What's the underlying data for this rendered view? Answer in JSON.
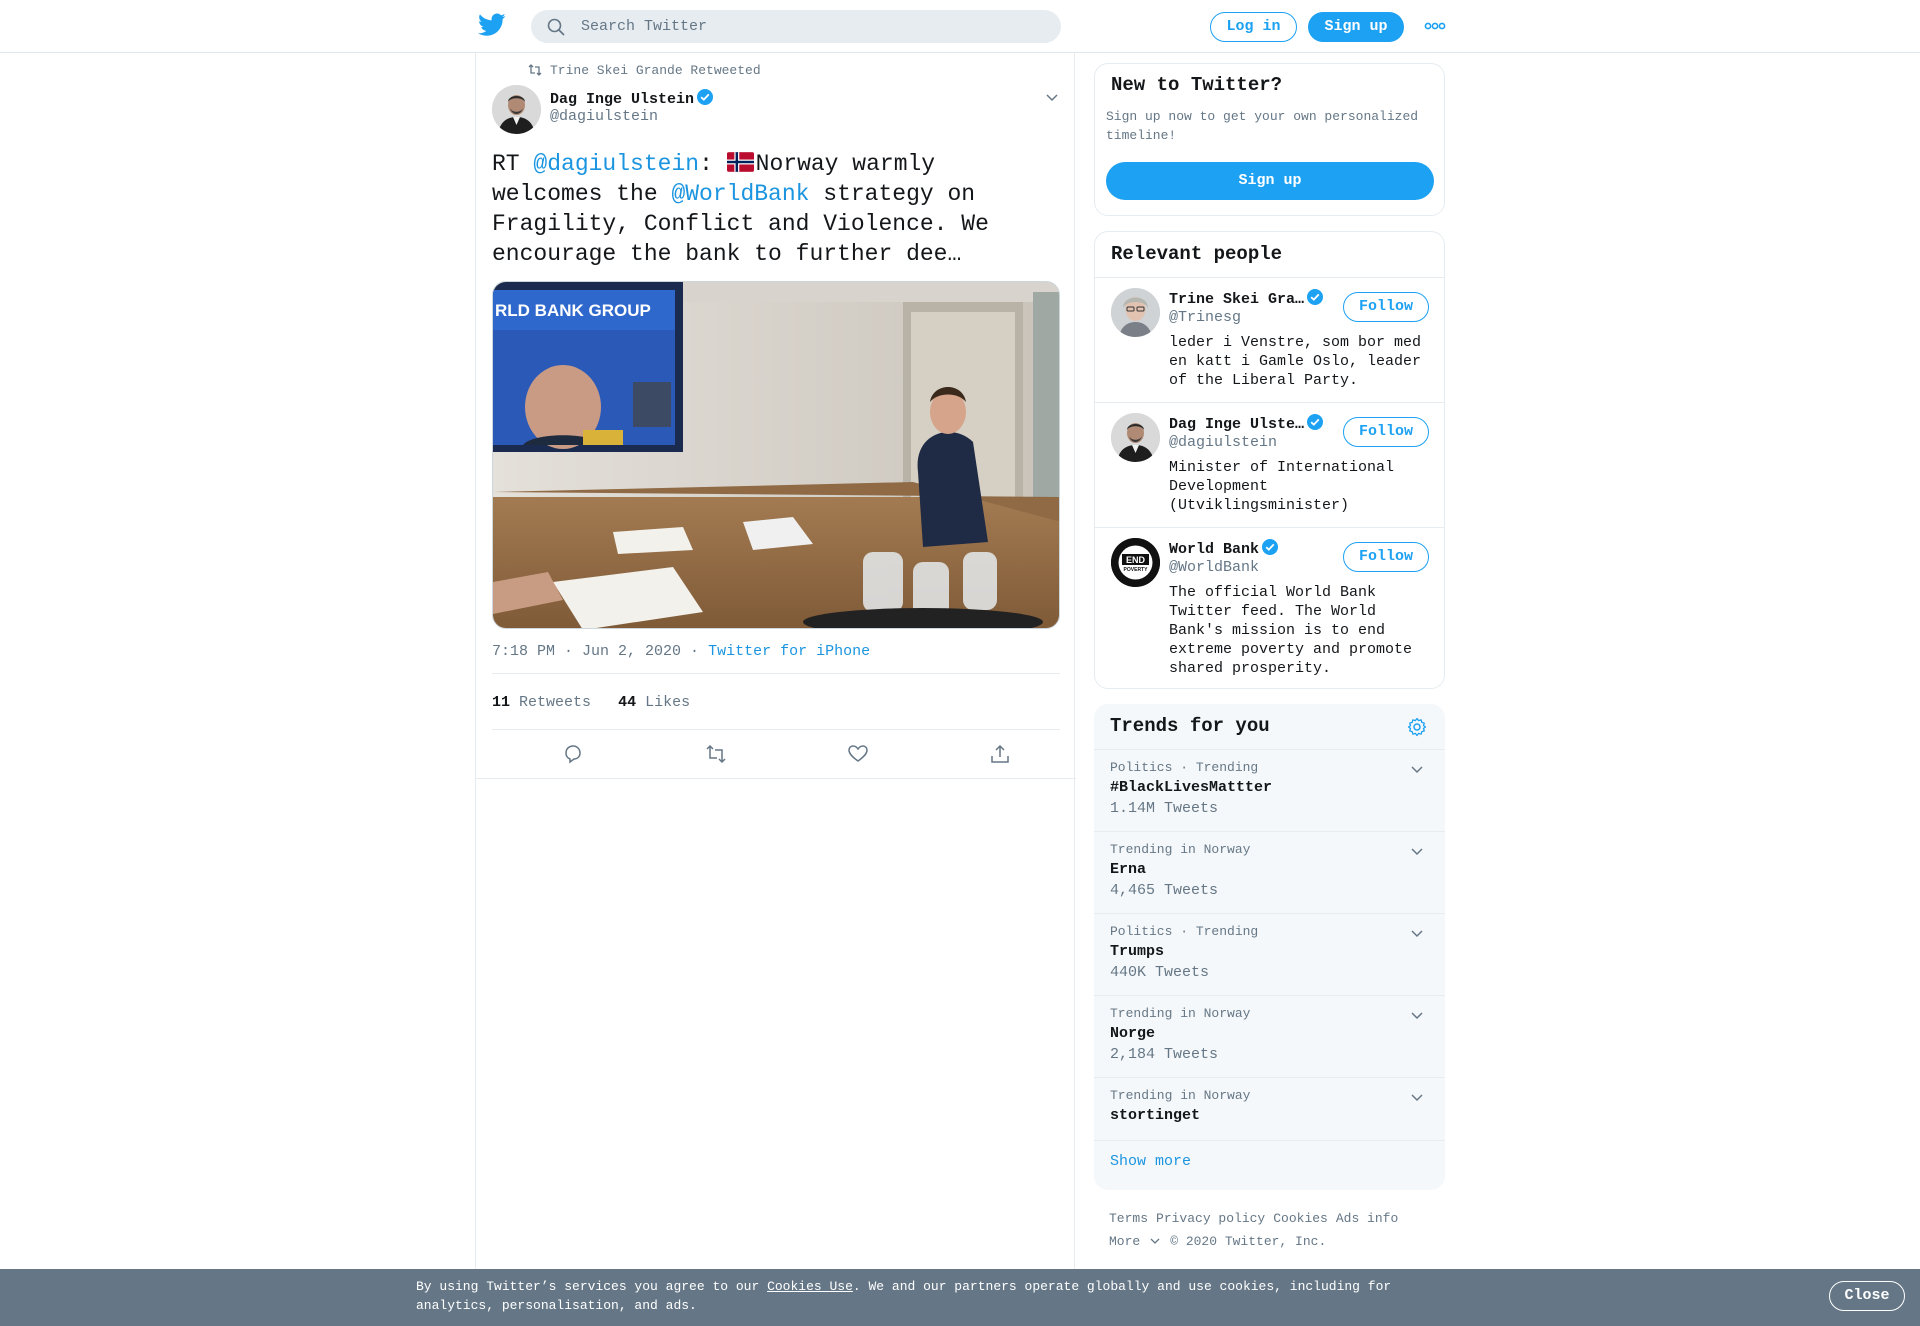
{
  "header": {
    "search_placeholder": "Search Twitter",
    "login_label": "Log in",
    "signup_label": "Sign up"
  },
  "tweet": {
    "retweeted_by": "Trine Skei Grande Retweeted",
    "author_name": "Dag Inge Ulstein",
    "author_handle": "@dagiulstein",
    "text_parts": {
      "rt": "RT ",
      "mention1": "@dagiulstein",
      "p1": ": ",
      "p2": "Norway warmly welcomes the ",
      "mention2": "@WorldBank",
      "p3": " strategy on Fragility, Conflict and Violence. We encourage the bank to further dee…"
    },
    "image_text": "RLD BANK GROUP",
    "time": "7:18 PM · Jun 2, 2020",
    "dot": "·",
    "source": "Twitter for iPhone",
    "retweets_count": "11",
    "retweets_label": "Retweets",
    "likes_count": "44",
    "likes_label": "Likes"
  },
  "new_to_twitter": {
    "title": "New to Twitter?",
    "text": "Sign up now to get your own personalized timeline!",
    "button": "Sign up"
  },
  "relevant_people": {
    "title": "Relevant people",
    "people": [
      {
        "name": "Trine Skei Gra…",
        "handle": "@Trinesg",
        "bio": "leder i Venstre, som bor med en katt i Gamle Oslo, leader of the Liberal Party.",
        "follow": "Follow"
      },
      {
        "name": "Dag Inge Ulste…",
        "handle": "@dagiulstein",
        "bio": "Minister of International Development (Utviklingsminister)",
        "follow": "Follow"
      },
      {
        "name": "World Bank",
        "handle": "@WorldBank",
        "bio": "The official World Bank Twitter feed. The World Bank's mission is to end extreme poverty and promote shared prosperity.",
        "follow": "Follow",
        "avatar_text_1": "END",
        "avatar_text_2": "POVERTY"
      }
    ]
  },
  "trends": {
    "title": "Trends for you",
    "items": [
      {
        "context": "Politics · Trending",
        "name": "#BlackLivesMattter",
        "count": "1.14M Tweets"
      },
      {
        "context": "Trending in Norway",
        "name": "Erna",
        "count": "4,465 Tweets"
      },
      {
        "context": "Politics · Trending",
        "name": "Trumps",
        "count": "440K Tweets"
      },
      {
        "context": "Trending in Norway",
        "name": "Norge",
        "count": "2,184 Tweets"
      },
      {
        "context": "Trending in Norway",
        "name": "stortinget",
        "count": ""
      }
    ],
    "show_more": "Show more"
  },
  "footer": {
    "terms": "Terms",
    "privacy": "Privacy policy",
    "cookies": "Cookies",
    "ads": "Ads info",
    "more": "More",
    "copyright": "© 2020 Twitter, Inc."
  },
  "cookie_bar": {
    "text_before": "By using Twitter’s services you agree to our ",
    "link": "Cookies Use",
    "text_after": ". We and our partners operate globally and use cookies, including for analytics, personalisation, and ads.",
    "close": "Close"
  },
  "colors": {
    "brand_blue": "#1da1f2",
    "link_blue": "#1b95e0",
    "muted_gray": "#657786",
    "cookie_bar_bg": "#657786"
  },
  "icons": [
    "twitter-logo-icon",
    "search-icon",
    "more-dots-icon",
    "retweet-icon",
    "verified-icon",
    "chevron-down-icon",
    "reply-icon",
    "like-icon",
    "share-icon",
    "gear-icon"
  ]
}
